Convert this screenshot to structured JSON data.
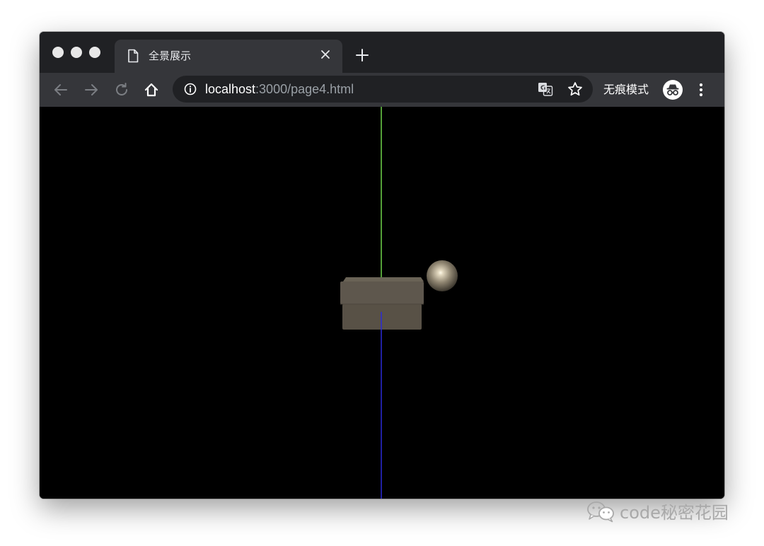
{
  "browser": {
    "tab": {
      "title": "全景展示",
      "icon": "page-icon"
    },
    "omnibox": {
      "url_host": "localhost",
      "url_rest": ":3000/page4.html"
    },
    "incognito_label": "无痕模式"
  },
  "icons": {
    "back": "arrow-left-icon",
    "forward": "arrow-right-icon",
    "reload": "reload-icon",
    "home": "home-icon",
    "info": "info-icon",
    "translate": "translate-icon",
    "bookmark": "star-icon",
    "incognito": "incognito-icon",
    "menu": "kebab-menu-icon",
    "close_tab": "close-icon",
    "new_tab": "plus-icon"
  },
  "scene": {
    "background": "#000000",
    "axes": {
      "x_color": "#d45a1a",
      "y_color": "#6fd34a",
      "z_color": "#3b3bd0"
    },
    "box_color": "#5e574d",
    "sphere_color": "#9a8e7a"
  },
  "watermark": {
    "text": "code秘密花园"
  },
  "colors": {
    "tabstrip": "#202124",
    "toolbar": "#35363a",
    "omnibox": "#202124"
  }
}
